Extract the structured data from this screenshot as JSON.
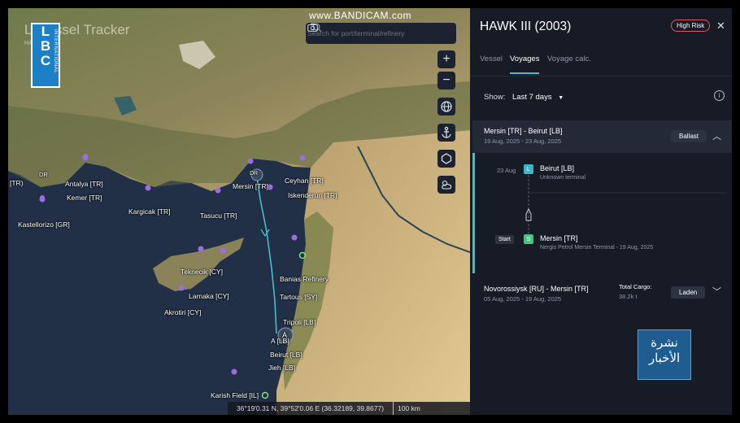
{
  "watermark": "www.BANDICAM.com",
  "logo": {
    "letters": [
      "L",
      "B",
      "C"
    ],
    "subtext": "INTERNATIONAL"
  },
  "app": {
    "title_visible": "Li   Vessel Tracker",
    "sub": "HA"
  },
  "search": {
    "placeholder": "Search for port/terminal/refinery"
  },
  "map_controls": {
    "zoom_in": "+",
    "zoom_out": "−"
  },
  "map_labels": [
    {
      "id": "tr-edge",
      "text": "[TR)"
    },
    {
      "id": "antalya",
      "text": "Antalya [TR]"
    },
    {
      "id": "kemer",
      "text": "Kemer [TR]"
    },
    {
      "id": "kastellorizo",
      "text": "Kastellorizo [GR]"
    },
    {
      "id": "kargicak",
      "text": "Kargicak [TR]"
    },
    {
      "id": "tasucu",
      "text": "Tasucu [TR]"
    },
    {
      "id": "mersin",
      "text": "Mersin [TR]"
    },
    {
      "id": "ceyhan",
      "text": "Ceyhan [TR]"
    },
    {
      "id": "iskenderun",
      "text": "Iskenderun [TR]"
    },
    {
      "id": "teknecik",
      "text": "Teknecik [CY]"
    },
    {
      "id": "larnaka",
      "text": "Larnaka [CY]"
    },
    {
      "id": "akrotiri",
      "text": "Akrotiri [CY]"
    },
    {
      "id": "banias",
      "text": "Banias Refinery"
    },
    {
      "id": "tartous",
      "text": "Tartous [SY]"
    },
    {
      "id": "tripoli",
      "text": "Tripoli [LB]"
    },
    {
      "id": "a-lb",
      "text": "A     [LB]"
    },
    {
      "id": "beirut",
      "text": "Beirut [LB]"
    },
    {
      "id": "jieh",
      "text": "Jieh [LB]"
    },
    {
      "id": "karish",
      "text": "Karish Field [IL]"
    }
  ],
  "markers": {
    "dr": "DR",
    "a": "A"
  },
  "status_bar": {
    "coords": "36°19'0.31 N, 39°52'0.06 E (36.32189, 39.8677)",
    "scale": "100 km"
  },
  "panel": {
    "vessel_title": "HAWK III (2003)",
    "risk_badge": "High Risk",
    "tabs": [
      "Vessel",
      "Voyages",
      "Voyage calc."
    ],
    "show_label": "Show:",
    "show_value": "Last 7 days",
    "voyage1": {
      "route": "Mersin [TR] - Beirut [LB]",
      "dates": "19 Aug, 2025 - 23 Aug, 2025",
      "status": "Ballast",
      "timeline": [
        {
          "date": "23 Aug",
          "badge": "L",
          "port": "Beirut [LB]",
          "sub": "Unknown terminal"
        },
        {
          "date": "Start",
          "badge": "S",
          "port": "Mersin [TR]",
          "sub": "Nergis Petrol Mersin Terminal - 19 Aug, 2025"
        }
      ]
    },
    "voyage2": {
      "route": "Novorossiysk [RU] - Mersin [TR]",
      "dates": "05 Aug, 2025 - 19 Aug, 2025",
      "cargo_label": "Total Cargo:",
      "cargo_value": "38.2k t",
      "status": "Laden"
    }
  },
  "news_logo": {
    "line1": "نشرة",
    "line2": "الأخبار"
  },
  "colors": {
    "accent": "#36c1cf",
    "risk": "#e25566",
    "panel_bg": "#171b25",
    "pin": "#9b6ee0",
    "node_l": "#3fb6c8",
    "node_s": "#4fbf88"
  }
}
